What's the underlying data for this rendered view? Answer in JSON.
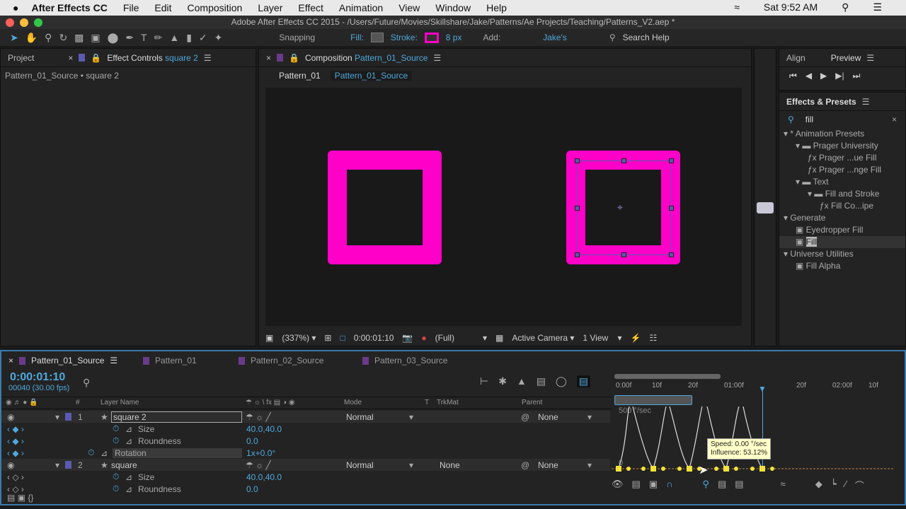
{
  "menubar": {
    "apple": "",
    "app": "After Effects CC",
    "items": [
      "File",
      "Edit",
      "Composition",
      "Layer",
      "Effect",
      "Animation",
      "View",
      "Window",
      "Help"
    ],
    "clock": "Sat 9:52 AM"
  },
  "window": {
    "title": "Adobe After Effects CC 2015 - /Users/Future/Movies/Skillshare/Jake/Patterns/Ae Projects/Teaching/Patterns_V2.aep *"
  },
  "toolbar": {
    "snapping": "Snapping",
    "fill": "Fill:",
    "stroke": "Stroke:",
    "stroke_width": "8 px",
    "add": "Add:",
    "workspace": "Jake's",
    "search": "Search Help",
    "stroke_color": "#ff00c8"
  },
  "left_panel": {
    "tab_project": "Project",
    "tab_effect_controls": "Effect Controls",
    "effect_layer": "square 2",
    "breadcrumb": "Pattern_01_Source • square 2"
  },
  "comp_panel": {
    "label": "Composition",
    "comp_name": "Pattern_01_Source",
    "nav": [
      "Pattern_01",
      "Pattern_01_Source"
    ],
    "zoom": "(337%)",
    "timecode": "0:00:01:10",
    "resolution": "(Full)",
    "camera": "Active Camera",
    "views": "1 View",
    "shape_color": "#ff00c8"
  },
  "right_panel": {
    "tab_align": "Align",
    "tab_preview": "Preview",
    "effects_title": "Effects & Presets",
    "search_value": "fill",
    "tree": [
      {
        "label": "* Animation Presets",
        "level": 0,
        "type": "group"
      },
      {
        "label": "Prager University",
        "level": 1,
        "type": "folder"
      },
      {
        "label": "Prager ...ue Fill",
        "level": 2,
        "type": "preset"
      },
      {
        "label": "Prager ...nge Fill",
        "level": 2,
        "type": "preset"
      },
      {
        "label": "Text",
        "level": 1,
        "type": "folder"
      },
      {
        "label": "Fill and Stroke",
        "level": 2,
        "type": "folder"
      },
      {
        "label": "Fill Co...ipe",
        "level": 3,
        "type": "preset"
      },
      {
        "label": "Generate",
        "level": 0,
        "type": "group"
      },
      {
        "label": "Eyedropper Fill",
        "level": 1,
        "type": "effect",
        "badge": "8"
      },
      {
        "label": "Fill",
        "level": 1,
        "type": "effect",
        "badge": "32",
        "selected": true
      },
      {
        "label": "Universe Utilities",
        "level": 0,
        "type": "group"
      },
      {
        "label": "Fill Alpha",
        "level": 1,
        "type": "effect",
        "badge": "32"
      }
    ]
  },
  "timeline": {
    "tabs": [
      "Pattern_01_Source",
      "Pattern_01",
      "Pattern_02_Source",
      "Pattern_03_Source"
    ],
    "timecode": "0:00:01:10",
    "frames": "00040 (30.00 fps)",
    "columns": {
      "hash": "#",
      "layer_name": "Layer Name",
      "mode": "Mode",
      "t": "T",
      "trkmat": "TrkMat",
      "parent": "Parent"
    },
    "layers": [
      {
        "num": "1",
        "name": "square 2",
        "mode": "Normal",
        "trkmat": "",
        "parent": "None",
        "props": [
          {
            "name": "Size",
            "value": "40.0,40.0"
          },
          {
            "name": "Roundness",
            "value": "0.0"
          },
          {
            "name": "Rotation",
            "value": "1x+0.0°"
          }
        ]
      },
      {
        "num": "2",
        "name": "square",
        "mode": "Normal",
        "trkmat": "None",
        "parent": "None",
        "props": [
          {
            "name": "Size",
            "value": "40.0,40.0"
          },
          {
            "name": "Roundness",
            "value": "0.0"
          }
        ]
      }
    ],
    "ruler": [
      "0:00f",
      "10f",
      "20f",
      "01:00f",
      "20f",
      "02:00f",
      "10f"
    ],
    "graph": {
      "speed_label": "500 °/sec",
      "zero": "0",
      "tooltip_speed": "Speed: 0.00 °/sec",
      "tooltip_influence": "Influence: 53.12%"
    }
  }
}
